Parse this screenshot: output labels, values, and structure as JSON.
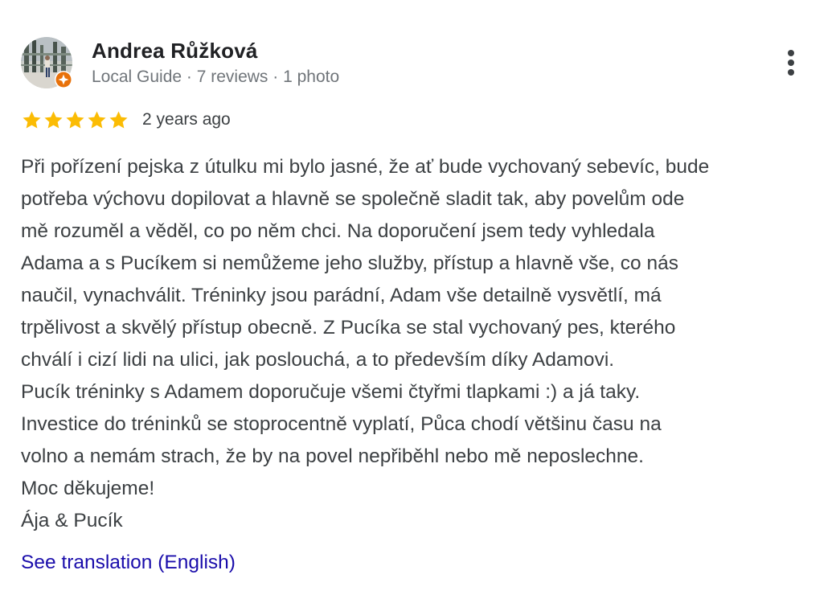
{
  "author": {
    "name": "Andrea Růžková",
    "meta": "Local Guide · 7 reviews · 1 photo",
    "avatar_icon": "user-photo",
    "badge_icon": "local-guide-badge-icon"
  },
  "menu": {
    "icon": "more-vert-icon"
  },
  "rating": {
    "stars": 5,
    "max_stars": 5,
    "date": "2 years ago",
    "star_color": "#fbbc04"
  },
  "review": {
    "lines": [
      "Při pořízení pejska z útulku mi bylo jasné, že ať bude vychovaný sebevíc, bude",
      "potřeba výchovu dopilovat a hlavně se společně sladit tak, aby povelům ode",
      "mě rozuměl a věděl, co po něm chci. Na doporučení jsem tedy vyhledala",
      "Adama a s Pucíkem si nemůžeme jeho služby, přístup a hlavně vše, co nás",
      "naučil, vynachválit. Tréninky jsou parádní, Adam vše detailně vysvětlí, má",
      "trpělivost a skvělý přístup obecně. Z Pucíka se stal vychovaný pes, kterého",
      "chválí i cizí lidi na ulici, jak poslouchá, a to především díky Adamovi.",
      "Pucík tréninky s Adamem doporučuje všemi čtyřmi tlapkami :) a já taky.",
      "Investice do tréninků se stoprocentně vyplatí, Půca chodí většinu času na",
      "volno a nemám strach, že by na povel nepřiběhl nebo mě neposlechne.",
      "Moc děkujeme!",
      "Ája & Pucík"
    ]
  },
  "translation": {
    "link_label": "See translation (English)",
    "link_color": "#1a0dab"
  }
}
